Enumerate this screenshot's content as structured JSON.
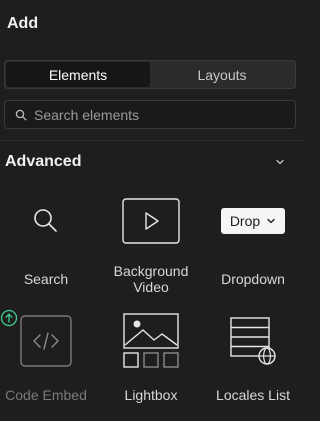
{
  "header": {
    "title": "Add"
  },
  "tabs": [
    {
      "label": "Elements",
      "active": true
    },
    {
      "label": "Layouts",
      "active": false
    }
  ],
  "search": {
    "placeholder": "Search elements",
    "value": ""
  },
  "section": {
    "title": "Advanced",
    "expanded": true
  },
  "items": [
    {
      "label": "Search",
      "icon": "magnifier-icon"
    },
    {
      "label_line1": "Background",
      "label_line2": "Video",
      "icon": "play-icon"
    },
    {
      "label": "Dropdown",
      "icon": "dropdown-pill-icon",
      "pill_text": "Drop"
    },
    {
      "label": "Code Embed",
      "icon": "code-icon",
      "disabled": true,
      "badge": "upgrade-icon"
    },
    {
      "label": "Lightbox",
      "icon": "lightbox-icon"
    },
    {
      "label": "Locales List",
      "icon": "locales-list-icon"
    }
  ],
  "colors": {
    "background": "#1e1e1e",
    "tab_active": "#161616",
    "accent_green": "#3ecf8e"
  }
}
